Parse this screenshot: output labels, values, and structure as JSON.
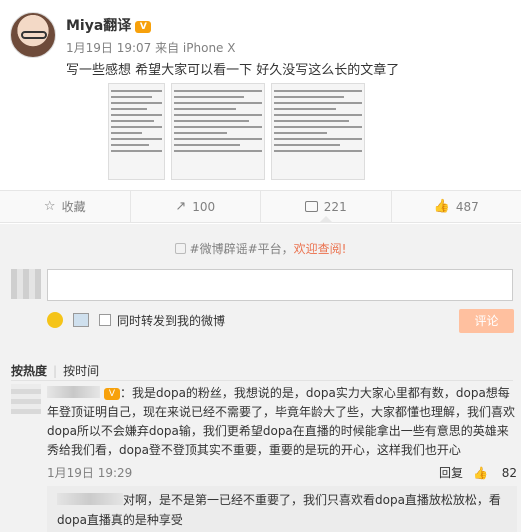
{
  "post": {
    "username": "Miya翻译",
    "vip_badge": "V",
    "meta": "1月19日 19:07 来自 iPhone X",
    "text": "写一些感想 希望大家可以看一下 好久没写这么长的文章了"
  },
  "actions": {
    "collect": "收藏",
    "repost_count": "100",
    "comment_count": "221",
    "like_count": "487"
  },
  "comments_area": {
    "topic_prefix": "#微博辟谣#平台，",
    "topic_link": "欢迎查阅!",
    "input_placeholder": "",
    "repost_checkbox_label": "同时转发到我的微博",
    "submit_label": "评论",
    "sort_hot": "按热度",
    "sort_time": "按时间"
  },
  "comment": {
    "text": "：我是dopa的粉丝，我想说的是，dopa实力大家心里都有数，dopa想每年登顶证明自己，现在来说已经不需要了，毕竟年龄大了些，大家都懂也理解，我们喜欢dopa所以不会嫌弃dopa输，我们更希望dopa在直播的时候能拿出一些有意思的英雄来秀给我们看，dopa登不登顶其实不重要，重要的是玩的开心，这样我们也开心",
    "time": "1月19日 19:29",
    "reply_label": "回复",
    "like_count": "82",
    "reply_text": "对啊，是不是第一已经不重要了，我们只喜欢看dopa直播放松放松，看dopa直播真的是种享受"
  },
  "colors": {
    "accent": "#eb7350",
    "submit_bg": "#ffc09f",
    "vip": "#f7a10c"
  }
}
